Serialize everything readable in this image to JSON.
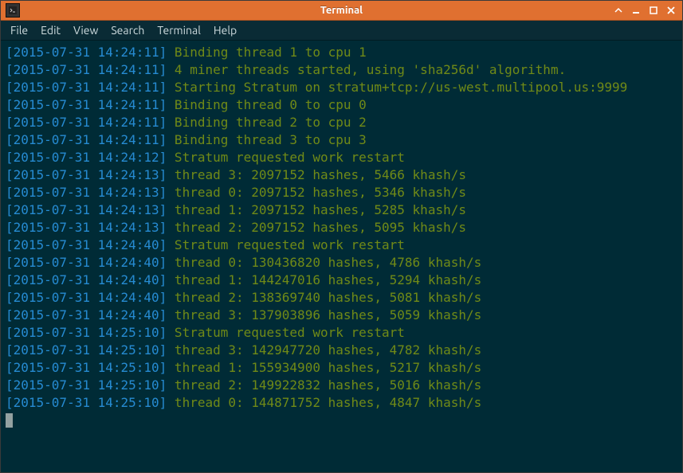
{
  "window": {
    "title": "Terminal"
  },
  "menu": {
    "items": [
      "File",
      "Edit",
      "View",
      "Search",
      "Terminal",
      "Help"
    ]
  },
  "log": {
    "lines": [
      {
        "ts": "[2015-07-31 14:24:11]",
        "msg": " Binding thread 1 to cpu 1"
      },
      {
        "ts": "[2015-07-31 14:24:11]",
        "msg": " 4 miner threads started, using 'sha256d' algorithm."
      },
      {
        "ts": "[2015-07-31 14:24:11]",
        "msg": " Starting Stratum on stratum+tcp://us-west.multipool.us:9999"
      },
      {
        "ts": "[2015-07-31 14:24:11]",
        "msg": " Binding thread 0 to cpu 0"
      },
      {
        "ts": "[2015-07-31 14:24:11]",
        "msg": " Binding thread 2 to cpu 2"
      },
      {
        "ts": "[2015-07-31 14:24:11]",
        "msg": " Binding thread 3 to cpu 3"
      },
      {
        "ts": "[2015-07-31 14:24:12]",
        "msg": " Stratum requested work restart"
      },
      {
        "ts": "[2015-07-31 14:24:13]",
        "msg": " thread 3: 2097152 hashes, 5466 khash/s"
      },
      {
        "ts": "[2015-07-31 14:24:13]",
        "msg": " thread 0: 2097152 hashes, 5346 khash/s"
      },
      {
        "ts": "[2015-07-31 14:24:13]",
        "msg": " thread 1: 2097152 hashes, 5285 khash/s"
      },
      {
        "ts": "[2015-07-31 14:24:13]",
        "msg": " thread 2: 2097152 hashes, 5095 khash/s"
      },
      {
        "ts": "[2015-07-31 14:24:40]",
        "msg": " Stratum requested work restart"
      },
      {
        "ts": "[2015-07-31 14:24:40]",
        "msg": " thread 0: 130436820 hashes, 4786 khash/s"
      },
      {
        "ts": "[2015-07-31 14:24:40]",
        "msg": " thread 1: 144247016 hashes, 5294 khash/s"
      },
      {
        "ts": "[2015-07-31 14:24:40]",
        "msg": " thread 2: 138369740 hashes, 5081 khash/s"
      },
      {
        "ts": "[2015-07-31 14:24:40]",
        "msg": " thread 3: 137903896 hashes, 5059 khash/s"
      },
      {
        "ts": "[2015-07-31 14:25:10]",
        "msg": " Stratum requested work restart"
      },
      {
        "ts": "[2015-07-31 14:25:10]",
        "msg": " thread 3: 142947720 hashes, 4782 khash/s"
      },
      {
        "ts": "[2015-07-31 14:25:10]",
        "msg": " thread 1: 155934900 hashes, 5217 khash/s"
      },
      {
        "ts": "[2015-07-31 14:25:10]",
        "msg": " thread 2: 149922832 hashes, 5016 khash/s"
      },
      {
        "ts": "[2015-07-31 14:25:10]",
        "msg": " thread 0: 144871752 hashes, 4847 khash/s"
      }
    ]
  }
}
